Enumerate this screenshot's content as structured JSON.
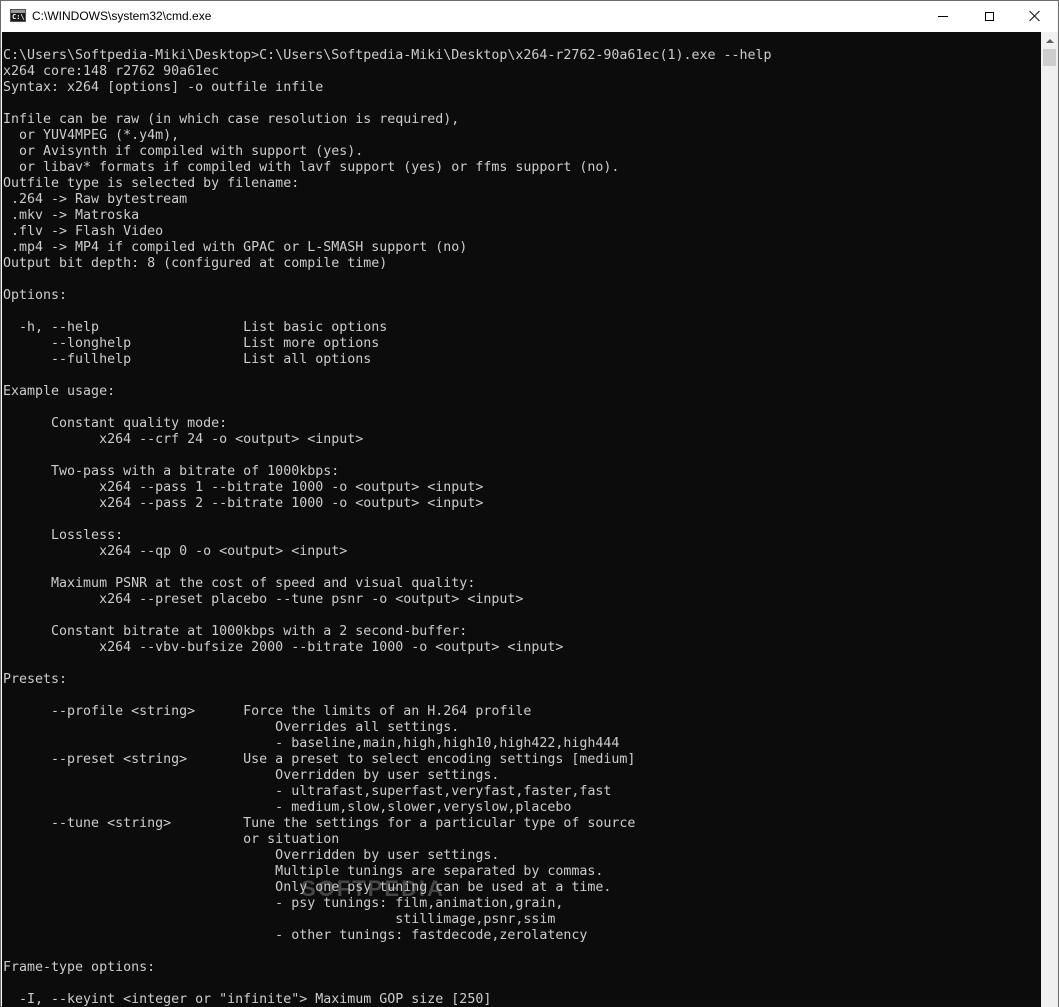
{
  "window": {
    "title": "C:\\WINDOWS\\system32\\cmd.exe",
    "icon_name": "cmd-icon",
    "icon_text": "C:\\",
    "controls": {
      "minimize": "minimize-icon",
      "maximize": "maximize-icon",
      "close": "close-icon"
    }
  },
  "console": {
    "background": "#0c0c0c",
    "foreground": "#cccccc",
    "lines": [
      "C:\\Users\\Softpedia-Miki\\Desktop>C:\\Users\\Softpedia-Miki\\Desktop\\x264-r2762-90a61ec(1).exe --help",
      "x264 core:148 r2762 90a61ec",
      "Syntax: x264 [options] -o outfile infile",
      "",
      "Infile can be raw (in which case resolution is required),",
      "  or YUV4MPEG (*.y4m),",
      "  or Avisynth if compiled with support (yes).",
      "  or libav* formats if compiled with lavf support (yes) or ffms support (no).",
      "Outfile type is selected by filename:",
      " .264 -> Raw bytestream",
      " .mkv -> Matroska",
      " .flv -> Flash Video",
      " .mp4 -> MP4 if compiled with GPAC or L-SMASH support (no)",
      "Output bit depth: 8 (configured at compile time)",
      "",
      "Options:",
      "",
      "  -h, --help                  List basic options",
      "      --longhelp              List more options",
      "      --fullhelp              List all options",
      "",
      "Example usage:",
      "",
      "      Constant quality mode:",
      "            x264 --crf 24 -o <output> <input>",
      "",
      "      Two-pass with a bitrate of 1000kbps:",
      "            x264 --pass 1 --bitrate 1000 -o <output> <input>",
      "            x264 --pass 2 --bitrate 1000 -o <output> <input>",
      "",
      "      Lossless:",
      "            x264 --qp 0 -o <output> <input>",
      "",
      "      Maximum PSNR at the cost of speed and visual quality:",
      "            x264 --preset placebo --tune psnr -o <output> <input>",
      "",
      "      Constant bitrate at 1000kbps with a 2 second-buffer:",
      "            x264 --vbv-bufsize 2000 --bitrate 1000 -o <output> <input>",
      "",
      "Presets:",
      "",
      "      --profile <string>      Force the limits of an H.264 profile",
      "                                  Overrides all settings.",
      "                                  - baseline,main,high,high10,high422,high444",
      "      --preset <string>       Use a preset to select encoding settings [medium]",
      "                                  Overridden by user settings.",
      "                                  - ultrafast,superfast,veryfast,faster,fast",
      "                                  - medium,slow,slower,veryslow,placebo",
      "      --tune <string>         Tune the settings for a particular type of source",
      "                              or situation",
      "                                  Overridden by user settings.",
      "                                  Multiple tunings are separated by commas.",
      "                                  Only one psy tuning can be used at a time.",
      "                                  - psy tunings: film,animation,grain,",
      "                                                 stillimage,psnr,ssim",
      "                                  - other tunings: fastdecode,zerolatency",
      "",
      "Frame-type options:",
      "",
      "  -I, --keyint <integer or \"infinite\"> Maximum GOP size [250]"
    ]
  },
  "watermark": "SOFTPEDIA",
  "scrollbar": {
    "up_arrow": "scroll-up-arrow-icon"
  }
}
